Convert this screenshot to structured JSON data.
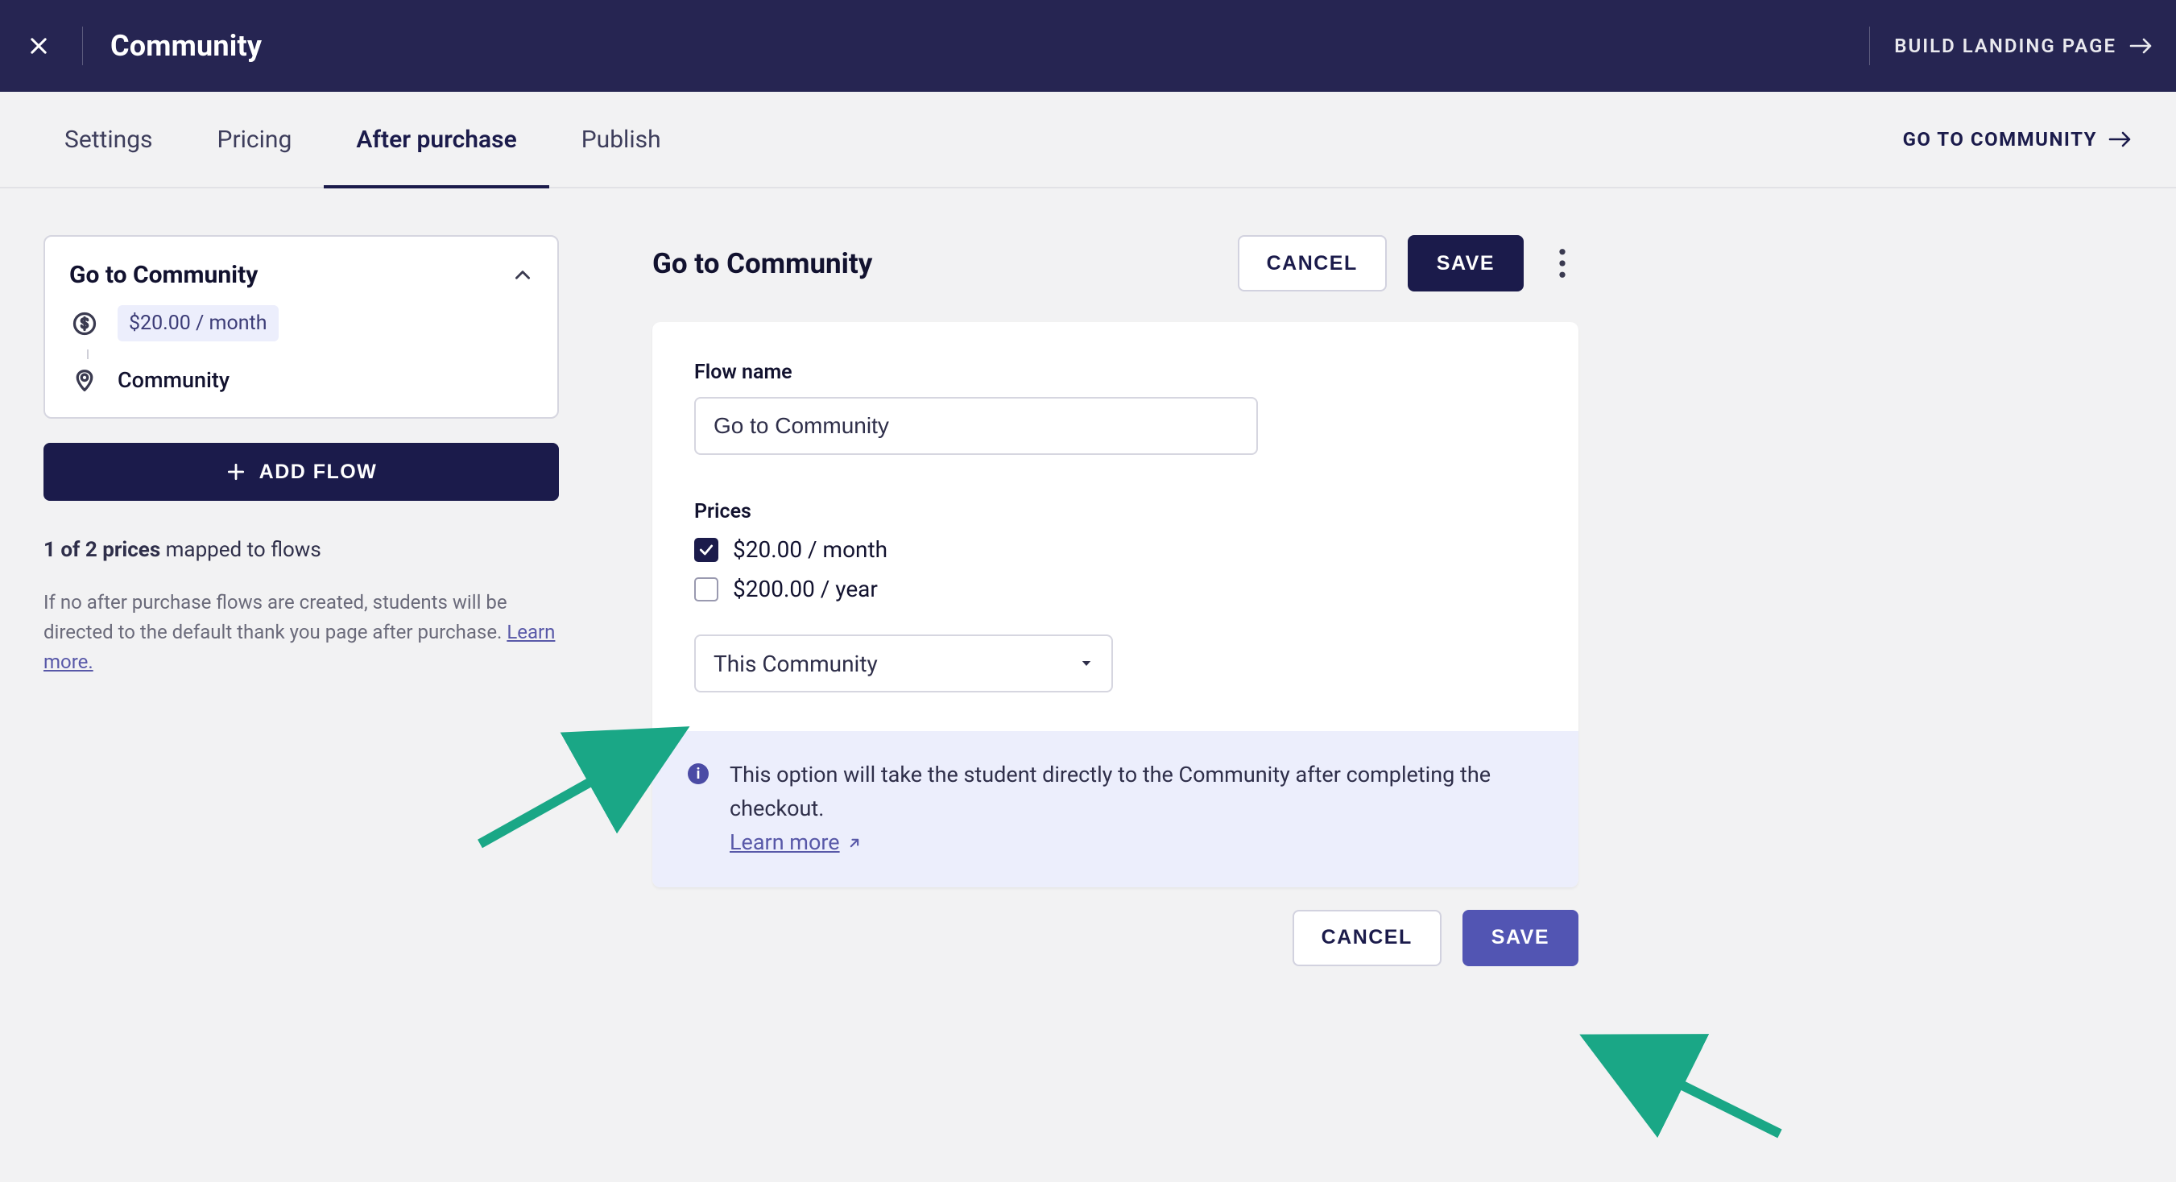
{
  "topbar": {
    "title": "Community",
    "build_landing": "BUILD LANDING PAGE"
  },
  "tabs": {
    "settings": "Settings",
    "pricing": "Pricing",
    "after_purchase": "After purchase",
    "publish": "Publish",
    "go_to_community": "GO TO COMMUNITY"
  },
  "sidebar": {
    "flow_title": "Go to Community",
    "price_badge": "$20.00 / month",
    "destination": "Community",
    "add_flow": "ADD FLOW",
    "mapped_bold": "1 of 2 prices",
    "mapped_tail": " mapped to flows",
    "help_text": "If no after purchase flows are created, students will be directed to the default thank you page after purchase. ",
    "learn_more": "Learn more."
  },
  "editor": {
    "heading": "Go to Community",
    "cancel": "CANCEL",
    "save": "SAVE",
    "flow_name_label": "Flow name",
    "flow_name_value": "Go to Community",
    "prices_label": "Prices",
    "price1": "$20.00 / month",
    "price2": "$200.00 / year",
    "select_value": "This Community",
    "info_text": "This option will take the student directly to the Community after completing the checkout.",
    "info_learn_more": "Learn more "
  },
  "footer": {
    "cancel": "CANCEL",
    "save": "SAVE"
  }
}
